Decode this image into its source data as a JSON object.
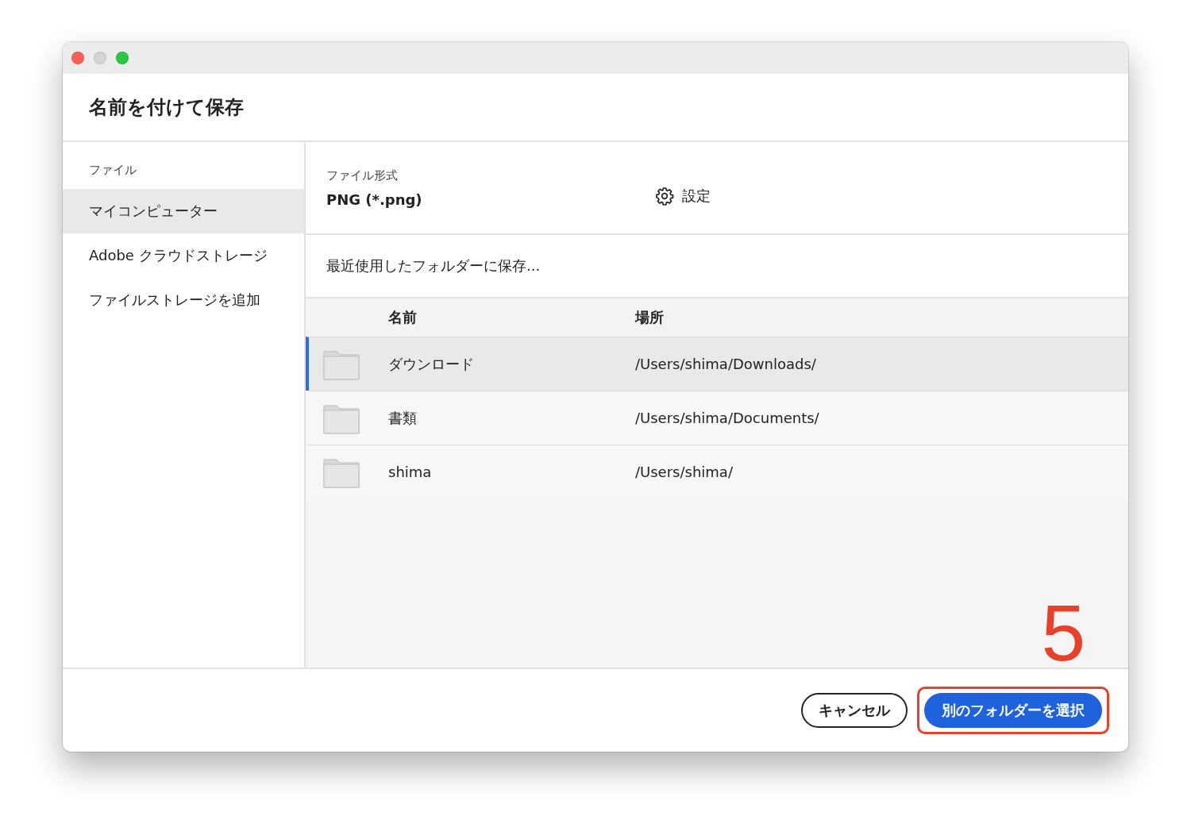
{
  "window": {
    "title": "名前を付けて保存"
  },
  "sidebar": {
    "section": "ファイル",
    "items": [
      {
        "label": "マイコンピューター",
        "selected": true
      },
      {
        "label": "Adobe クラウドストレージ",
        "selected": false
      },
      {
        "label": "ファイルストレージを追加",
        "selected": false
      }
    ]
  },
  "format": {
    "label": "ファイル形式",
    "value": "PNG (*.png)",
    "settings": "設定"
  },
  "recent": {
    "label": "最近使用したフォルダーに保存..."
  },
  "table": {
    "columns": [
      "名前",
      "場所"
    ],
    "rows": [
      {
        "name": "ダウンロード",
        "location": "/Users/shima/Downloads/",
        "selected": true
      },
      {
        "name": "書類",
        "location": "/Users/shima/Documents/",
        "selected": false
      },
      {
        "name": "shima",
        "location": "/Users/shima/",
        "selected": false
      }
    ]
  },
  "buttons": {
    "cancel": "キャンセル",
    "choose": "別のフォルダーを選択"
  },
  "annotation": {
    "label": "5"
  }
}
